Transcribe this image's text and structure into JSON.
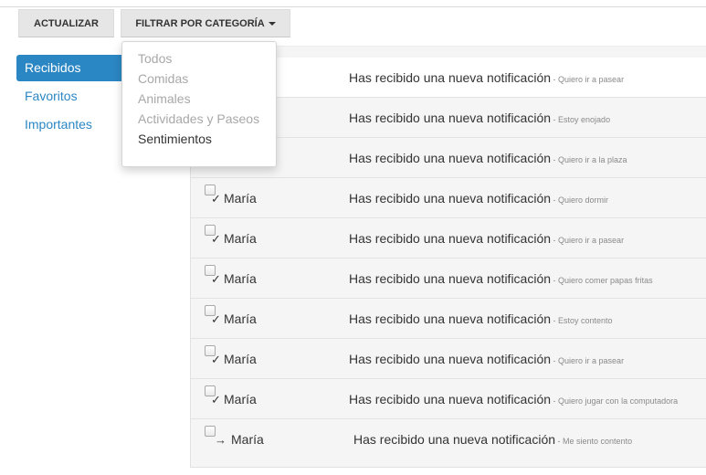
{
  "toolbar": {
    "update_label": "ACTUALIZAR",
    "filter_label": "FILTRAR POR CATEGORÍA"
  },
  "sidebar": {
    "items": [
      {
        "label": "Recibidos",
        "active": true
      },
      {
        "label": "Favoritos"
      },
      {
        "label": "Importantes"
      }
    ]
  },
  "dropdown": {
    "items": [
      {
        "label": "Todos",
        "enabled": false
      },
      {
        "label": "Comidas",
        "enabled": false
      },
      {
        "label": "Animales",
        "enabled": false
      },
      {
        "label": "Actividades y Paseos",
        "enabled": false
      },
      {
        "label": "Sentimientos",
        "enabled": true
      }
    ]
  },
  "messages": [
    {
      "sender": "",
      "mark": "",
      "title": "Has recibido una nueva notificación",
      "preview": " - Quiero ir a pasear"
    },
    {
      "sender": "",
      "mark": "",
      "title": "Has recibido una nueva notificación",
      "preview": " - Estoy enojado"
    },
    {
      "sender": "",
      "mark": "",
      "title": "Has recibido una nueva notificación",
      "preview": " - Quiero ir a la plaza"
    },
    {
      "sender": "María",
      "mark": "✓",
      "title": "Has recibido una nueva notificación",
      "preview": " - Quiero dormir"
    },
    {
      "sender": "María",
      "mark": "✓",
      "title": "Has recibido una nueva notificación",
      "preview": " - Quiero ir a pasear"
    },
    {
      "sender": "María",
      "mark": "✓",
      "title": "Has recibido una nueva notificación",
      "preview": " - Quiero comer papas fritas"
    },
    {
      "sender": "María",
      "mark": "✓",
      "title": "Has recibido una nueva notificación",
      "preview": " - Estoy contento"
    },
    {
      "sender": "María",
      "mark": "✓",
      "title": "Has recibido una nueva notificación",
      "preview": " - Quiero ir a pasear"
    },
    {
      "sender": "María",
      "mark": "✓",
      "title": "Has recibido una nueva notificación",
      "preview": " - Quiero jugar con la computadora"
    },
    {
      "sender": "María",
      "mark": "→",
      "title": "Has recibido una nueva notificación",
      "preview": " - Me siento contento"
    }
  ]
}
